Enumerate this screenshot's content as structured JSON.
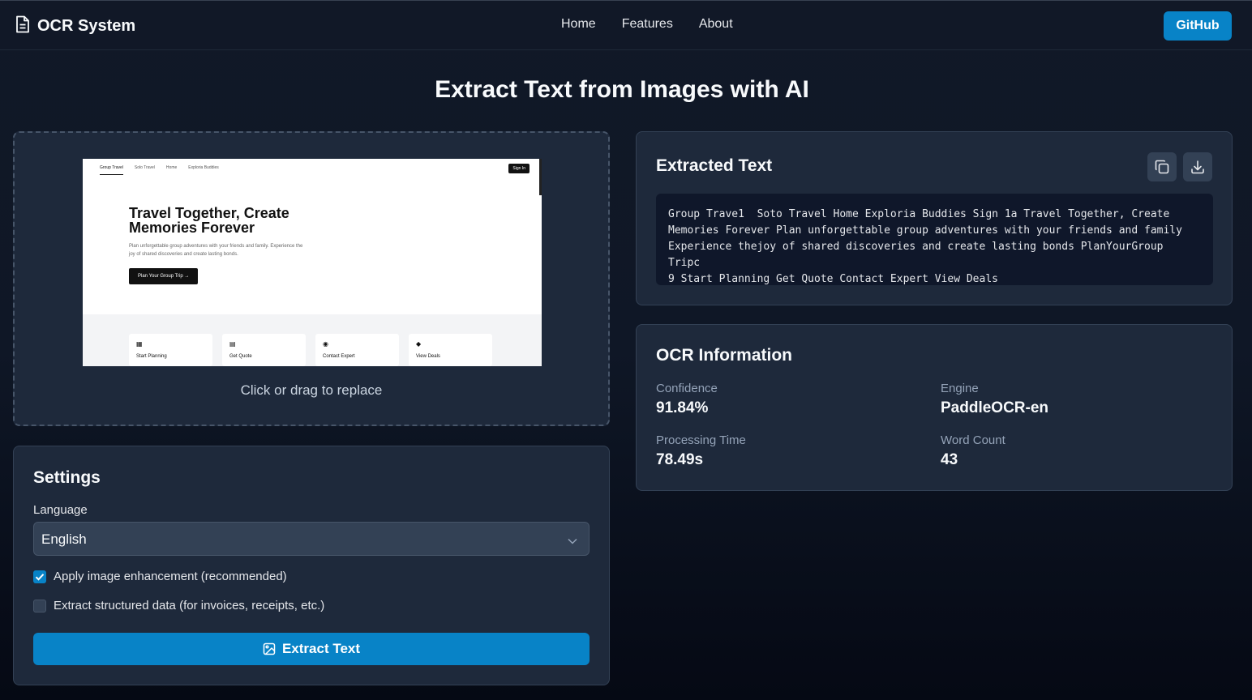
{
  "header": {
    "app_title": "OCR System",
    "nav": [
      "Home",
      "Features",
      "About"
    ],
    "github_label": "GitHub"
  },
  "page_title": "Extract Text from Images with AI",
  "upload": {
    "caption": "Click or drag to replace",
    "preview": {
      "nav": [
        "Group Travel",
        "Solo Travel",
        "Home",
        "Exploria Buddies"
      ],
      "sign_in": "Sign In",
      "heading": "Travel Together, Create Memories Forever",
      "subtext": "Plan unforgettable group adventures with your friends and family. Experience the joy of shared discoveries and create lasting bonds.",
      "cta": "Plan Your Group Trip →",
      "cards": [
        "Start Planning",
        "Get Quote",
        "Contact Expert",
        "View Deals"
      ]
    }
  },
  "settings": {
    "title": "Settings",
    "language_label": "Language",
    "language_value": "English",
    "options": [
      {
        "label": "Apply image enhancement (recommended)",
        "checked": true
      },
      {
        "label": "Extract structured data (for invoices, receipts, etc.)",
        "checked": false
      }
    ],
    "extract_label": "Extract Text"
  },
  "result": {
    "title": "Extracted Text",
    "text": "Group Trave1  Soto Travel Home Exploria Buddies Sign 1a Travel Together, Create\nMemories Forever Plan unforgettable group adventures with your friends and family\nExperience thejoy of shared discoveries and create lasting bonds PlanYourGroup Tripc\n9 Start Planning Get Quote Contact Expert View Deals"
  },
  "info": {
    "title": "OCR Information",
    "confidence_label": "Confidence",
    "confidence_value": "91.84%",
    "engine_label": "Engine",
    "engine_value": "PaddleOCR-en",
    "time_label": "Processing Time",
    "time_value": "78.49s",
    "words_label": "Word Count",
    "words_value": "43"
  },
  "colors": {
    "accent": "#0883c7",
    "panel": "#1e293b",
    "background": "#111827"
  },
  "icons": [
    "document-icon",
    "copy-icon",
    "download-icon",
    "image-icon",
    "chevron-down-icon",
    "check-icon"
  ]
}
